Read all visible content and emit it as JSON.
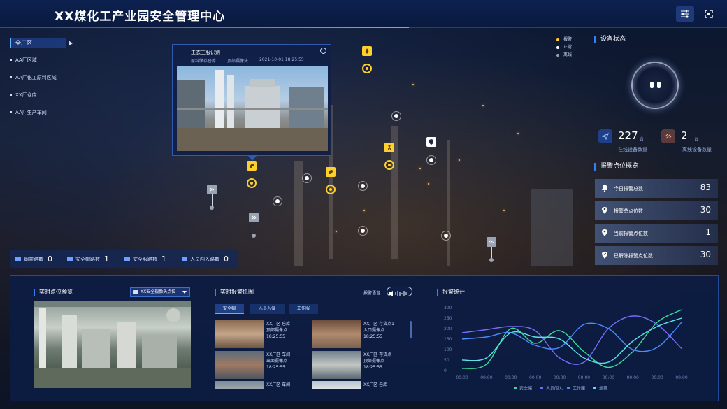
{
  "app": {
    "title": "XX煤化工产业园安全管理中心"
  },
  "menu": {
    "selected": "全厂区",
    "items": [
      "AA厂区域",
      "AA厂化工原料区域",
      "XX厂仓库",
      "AA厂生产车间"
    ]
  },
  "popup": {
    "title": "工衣工服识别",
    "location": "原料储存仓库",
    "camera": "顶部摄像头",
    "time": "2021-10-01 18:25:55"
  },
  "status_legend": [
    "报警",
    "正常",
    "离线"
  ],
  "colors": {
    "alarm": "#ffcf2c",
    "normal": "#ffffff",
    "offline": "#9aa3b5",
    "accent": "#3a7cff"
  },
  "device_status": {
    "title": "设备状态",
    "online": {
      "value": "227",
      "unit": "台",
      "label": "在线设备数量"
    },
    "offline": {
      "value": "2",
      "unit": "台",
      "label": "离线设备数量"
    }
  },
  "alarm_overview": {
    "title": "报警点位概览",
    "rows": [
      {
        "label": "今日报警总数",
        "value": "83",
        "icon": "alarm-bell-icon"
      },
      {
        "label": "报警总点位数",
        "value": "30",
        "icon": "location-alert-icon"
      },
      {
        "label": "当前报警点位数",
        "value": "1",
        "icon": "location-alert-icon"
      },
      {
        "label": "已解除报警点位数",
        "value": "30",
        "icon": "location-check-icon"
      }
    ]
  },
  "counts": [
    {
      "label": "烟雾路数",
      "value": "0",
      "icon": "smoke-icon"
    },
    {
      "label": "安全帽路数",
      "value": "1",
      "icon": "helmet-icon"
    },
    {
      "label": "安全服路数",
      "value": "1",
      "icon": "uniform-icon"
    },
    {
      "label": "人员闯入路数",
      "value": "0",
      "icon": "person-icon"
    }
  ],
  "preview": {
    "title": "实时点位预览",
    "camera_select": "XX安全摄像头点位"
  },
  "snapshots": {
    "title": "实时报警抓图",
    "voice_label": "报警语音",
    "tabs": [
      "安全帽",
      "人员入侵",
      "工作服"
    ],
    "items": [
      {
        "line1": "XX厂区 仓库",
        "line2": "顶部摄像点",
        "time": "18:25:55"
      },
      {
        "line1": "XX厂区 存货点1",
        "line2": "入口摄像点",
        "time": "18:25:55"
      },
      {
        "line1": "XX厂区 车间",
        "line2": "出面摄像点",
        "time": "18:25:55"
      },
      {
        "line1": "XX厂区 存货点",
        "line2": "顶部摄像点",
        "time": "18:25:55"
      },
      {
        "line1": "XX厂区 车间",
        "line2": "",
        "time": ""
      },
      {
        "line1": "XX厂区 仓库",
        "line2": "",
        "time": ""
      }
    ]
  },
  "chart_title": "报警统计",
  "chart_data": {
    "type": "line",
    "title": "报警统计",
    "x": [
      "00:00",
      "00:00",
      "00:00",
      "00:00",
      "00:00",
      "00:00",
      "00:00",
      "00:00",
      "00:00",
      "00:00"
    ],
    "ylim": [
      0,
      300
    ],
    "yticks": [
      0,
      50,
      100,
      150,
      200,
      250,
      300
    ],
    "grid": false,
    "legend_position": "bottom",
    "series": [
      {
        "name": "安全帽",
        "color": "#3ddc97",
        "values": [
          10,
          30,
          200,
          130,
          190,
          90,
          15,
          90,
          230,
          290
        ]
      },
      {
        "name": "人员闯入",
        "color": "#7a6cff",
        "values": [
          180,
          195,
          210,
          190,
          60,
          40,
          200,
          260,
          220,
          105
        ]
      },
      {
        "name": "工作服",
        "color": "#4a8cff",
        "values": [
          150,
          160,
          180,
          120,
          110,
          220,
          200,
          100,
          110,
          230
        ]
      },
      {
        "name": "烟雾",
        "color": "#5fe3e8",
        "values": [
          50,
          60,
          180,
          160,
          150,
          60,
          40,
          140,
          210,
          250
        ]
      }
    ]
  }
}
